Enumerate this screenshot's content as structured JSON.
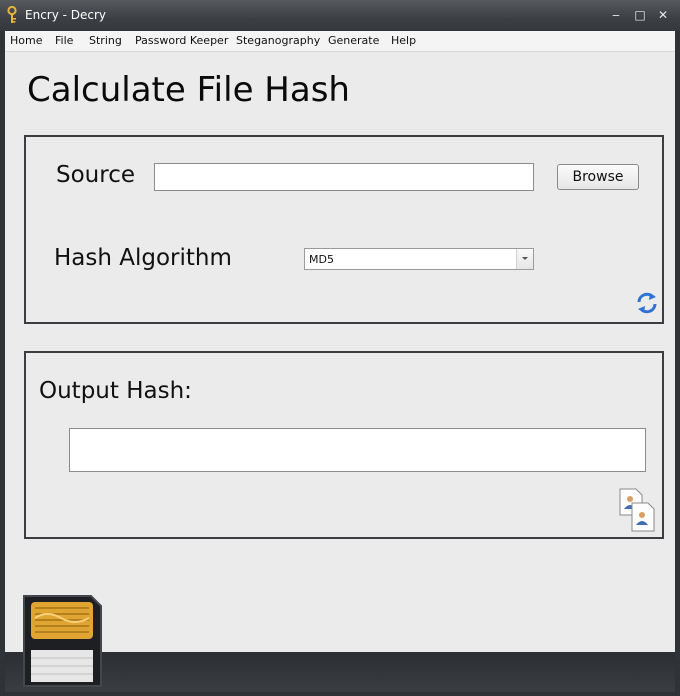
{
  "window": {
    "title": "Encry - Decry"
  },
  "window_controls": {
    "minimize": "‒",
    "maximize": "□",
    "close": "✕"
  },
  "menu": {
    "items": [
      {
        "label": "Home"
      },
      {
        "label": "File"
      },
      {
        "label": "String"
      },
      {
        "label": "Password Keeper"
      },
      {
        "label": "Steganography"
      },
      {
        "label": "Generate"
      },
      {
        "label": "Help"
      }
    ]
  },
  "page": {
    "heading": "Calculate File Hash"
  },
  "source": {
    "label": "Source",
    "value": "",
    "browse_label": "Browse"
  },
  "hash": {
    "label": "Hash Algorithm",
    "selected": "MD5"
  },
  "output": {
    "label": "Output Hash:",
    "value": ""
  },
  "icons": {
    "app": "key-icon",
    "refresh": "refresh-icon",
    "copy": "copy-documents-icon",
    "memory_card": "memory-card-icon"
  },
  "colors": {
    "accent": "#2f72d6",
    "frame": "#3b3d40",
    "background": "#ebebeb"
  }
}
